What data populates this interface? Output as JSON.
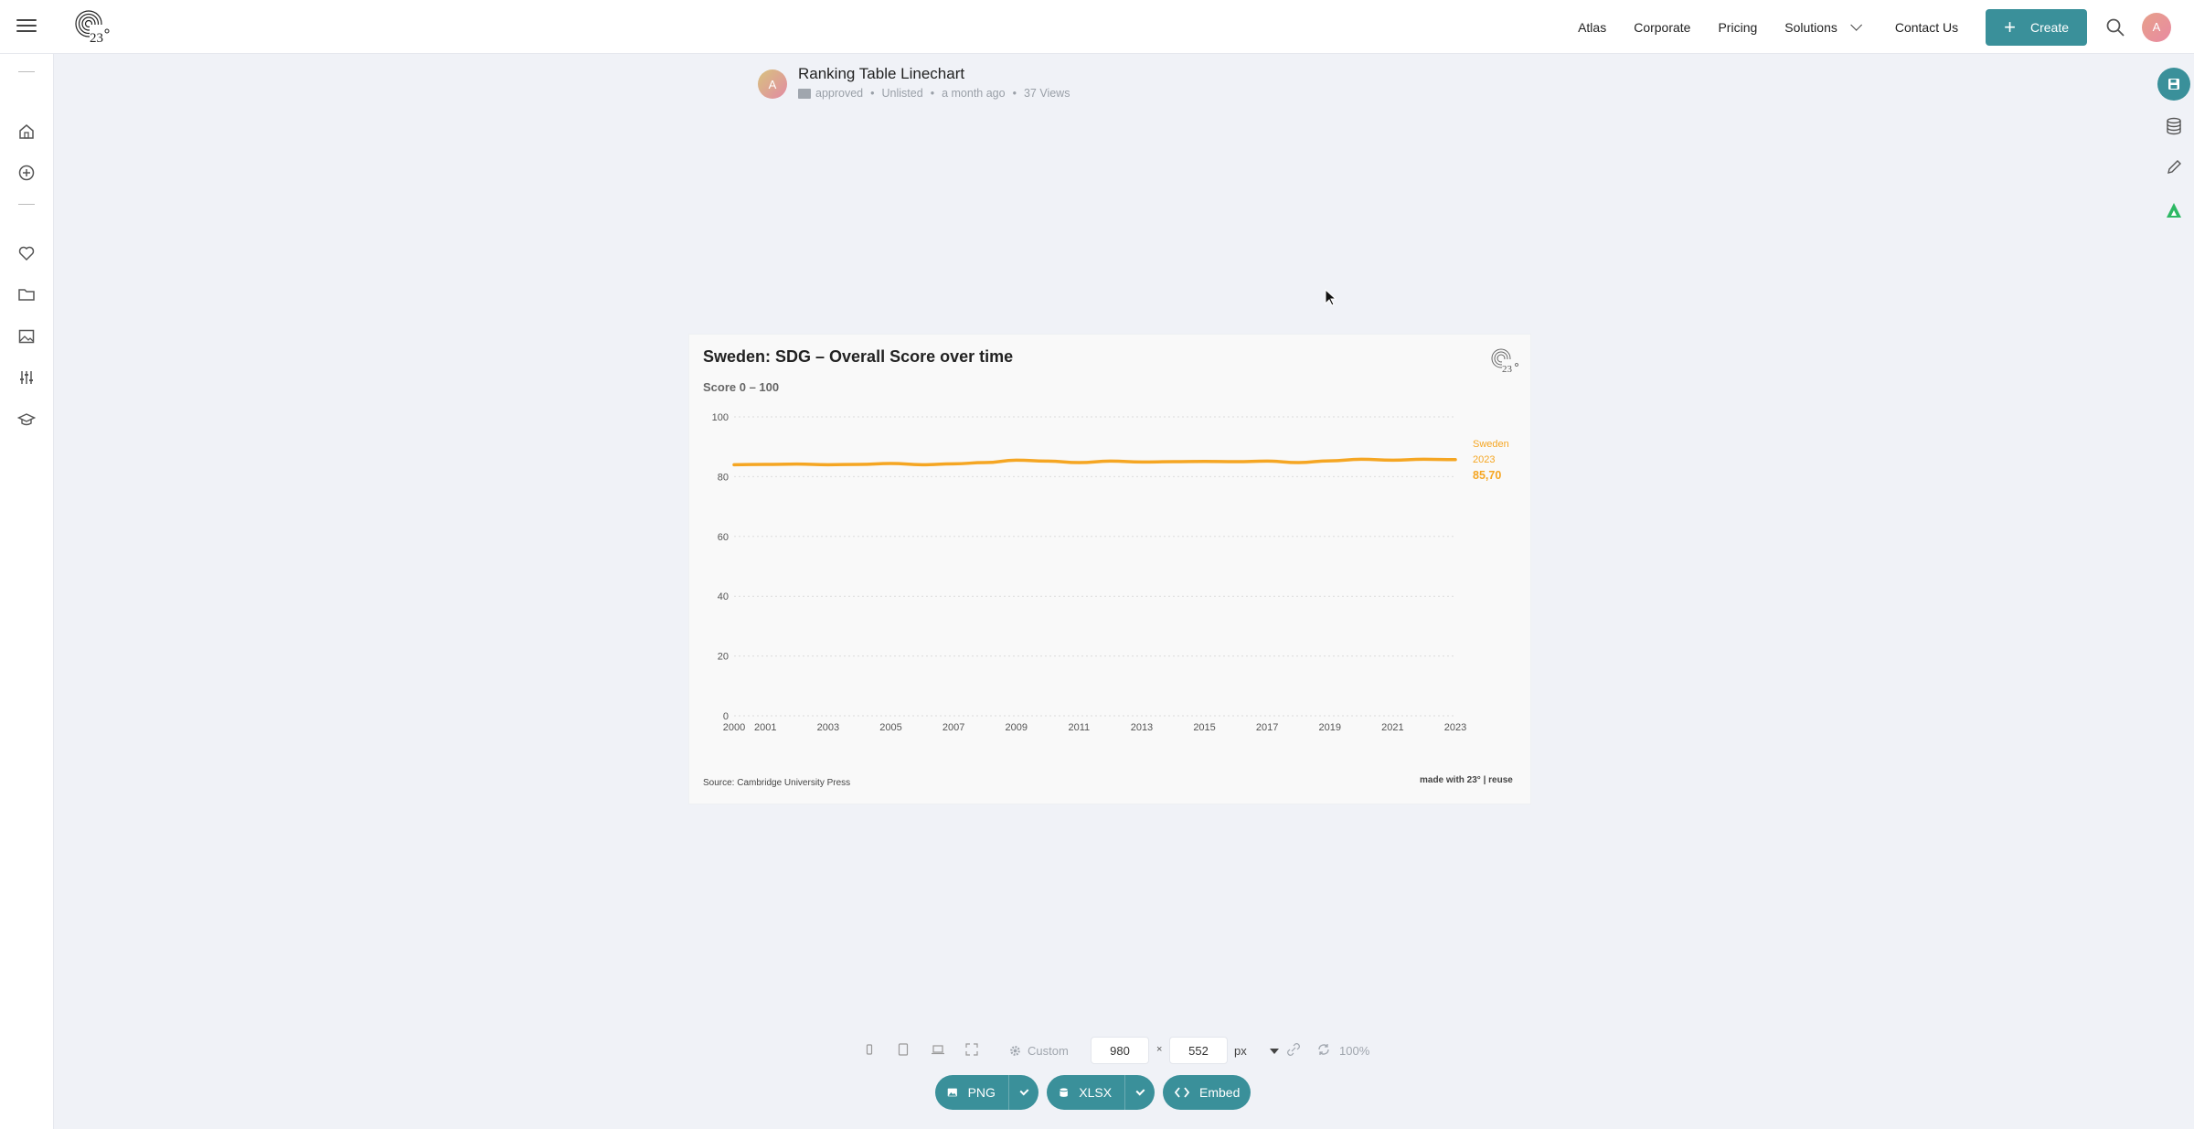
{
  "nav": {
    "links": [
      "Atlas",
      "Corporate",
      "Pricing"
    ],
    "solutions_label": "Solutions",
    "contact_label": "Contact Us",
    "create_label": "Create",
    "avatar_initial": "A"
  },
  "document": {
    "title": "Ranking Table Linechart",
    "avatar_initial": "A",
    "folder": "approved",
    "visibility": "Unlisted",
    "updated": "a month ago",
    "views": "37 Views"
  },
  "chart_data": {
    "type": "line",
    "title": "Sweden: SDG – Overall Score over time",
    "subtitle": "Score 0 – 100",
    "xlabel": "",
    "ylabel": "",
    "ylim": [
      0,
      100
    ],
    "yticks": [
      0,
      20,
      40,
      60,
      80,
      100
    ],
    "xlim": [
      2000,
      2023
    ],
    "xticks": [
      2000,
      2001,
      2003,
      2005,
      2007,
      2009,
      2011,
      2013,
      2015,
      2017,
      2019,
      2021,
      2023
    ],
    "grid": true,
    "series": [
      {
        "name": "Sweden",
        "color": "#f5a623",
        "x": [
          2000,
          2001,
          2002,
          2003,
          2004,
          2005,
          2006,
          2007,
          2008,
          2009,
          2010,
          2011,
          2012,
          2013,
          2014,
          2015,
          2016,
          2017,
          2018,
          2019,
          2020,
          2021,
          2022,
          2023
        ],
        "values": [
          84.0,
          84.1,
          84.2,
          84.0,
          84.1,
          84.4,
          84.0,
          84.3,
          84.7,
          85.5,
          85.2,
          84.7,
          85.2,
          84.9,
          85.0,
          85.1,
          85.0,
          85.2,
          84.7,
          85.3,
          85.8,
          85.5,
          85.8,
          85.7
        ]
      }
    ],
    "end_label": {
      "name": "Sweden",
      "year": "2023",
      "value": "85,70"
    },
    "source": "Source: Cambridge University Press",
    "made_with": "made with 23° | reuse"
  },
  "toolbar": {
    "preset_label": "Custom",
    "width": "980",
    "height": "552",
    "times": "×",
    "unit": "px",
    "zoom": "100%",
    "png_label": "PNG",
    "xlsx_label": "XLSX",
    "embed_label": "Embed"
  },
  "colors": {
    "accent": "#3a909a",
    "line": "#f5a623"
  }
}
